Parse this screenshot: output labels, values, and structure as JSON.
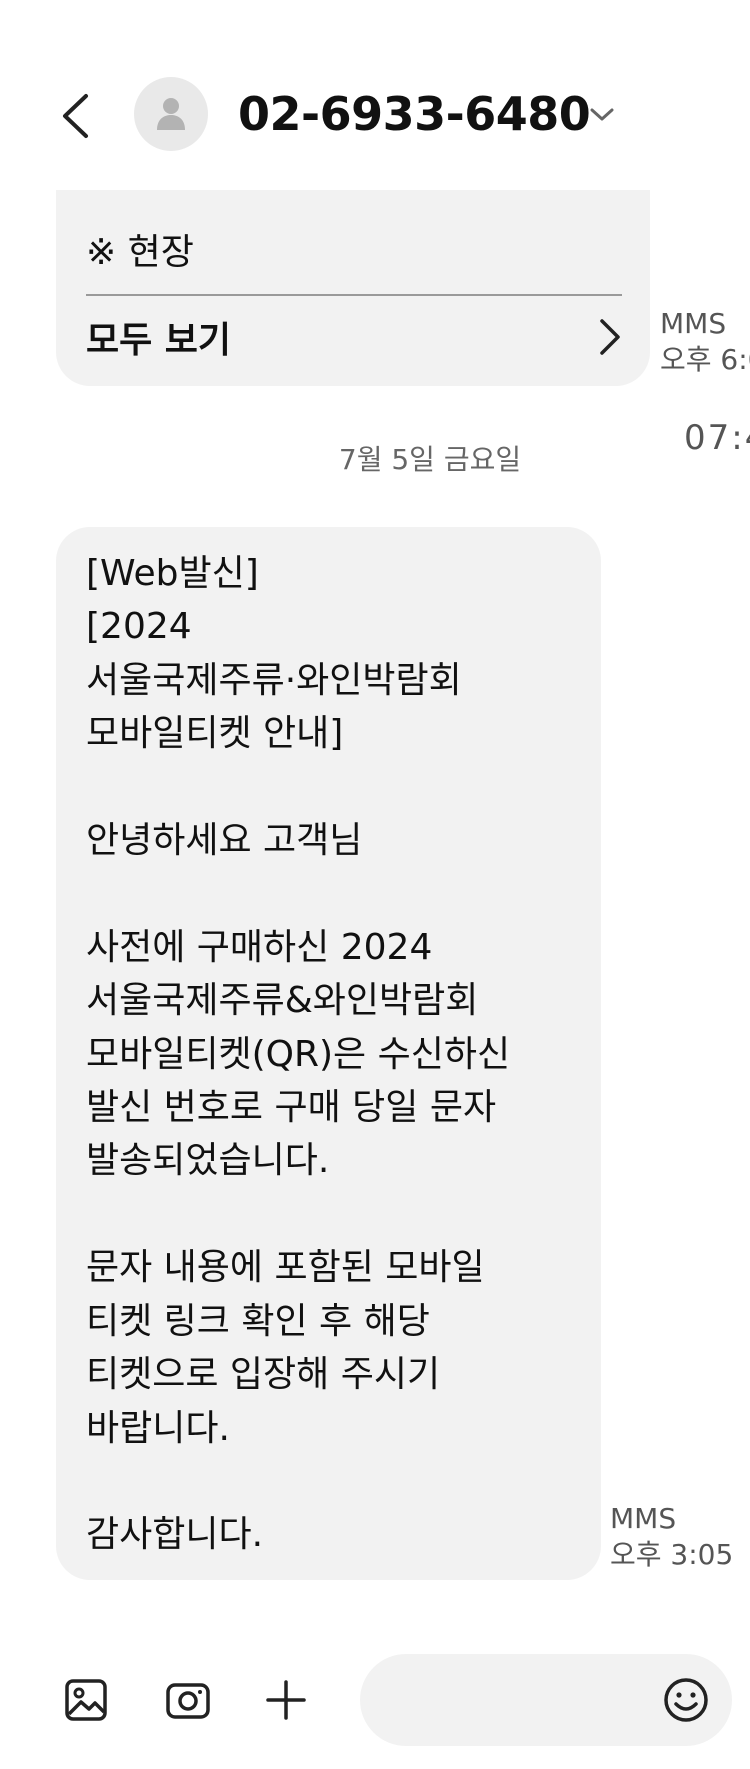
{
  "header": {
    "contact": "02-6933-6480"
  },
  "messages": [
    {
      "note": "※ 현장",
      "view_all_label": "모두 보기",
      "type": "MMS",
      "time": "오후 6:0"
    },
    {
      "text": "[Web발신]\n[2024\n서울국제주류·와인박람회\n모바일티켓 안내]\n\n안녕하세요 고객님\n\n사전에 구매하신 2024\n서울국제주류&와인박람회\n모바일티켓(QR)은 수신하신\n발신 번호로 구매 당일 문자\n발송되었습니다.\n\n문자 내용에 포함된 모바일\n티켓 링크 확인 후 해당\n티켓으로 입장해 주시기\n바랍니다.\n\n감사합니다.",
      "type": "MMS",
      "time": "오후 3:05"
    }
  ],
  "peek_time": "07:4",
  "date_separator": "7월 5일 금요일",
  "composer": {
    "placeholder": ""
  },
  "icons": {
    "back": "chevron-left-icon",
    "avatar": "person-icon",
    "dropdown": "chevron-down-icon",
    "view_all": "chevron-right-icon",
    "gallery": "gallery-icon",
    "camera": "camera-icon",
    "plus": "plus-icon",
    "emoji": "emoji-icon"
  },
  "colors": {
    "bubble": "#f2f2f2",
    "meta_text": "#555555",
    "avatar_bg": "#e9e9e9"
  }
}
